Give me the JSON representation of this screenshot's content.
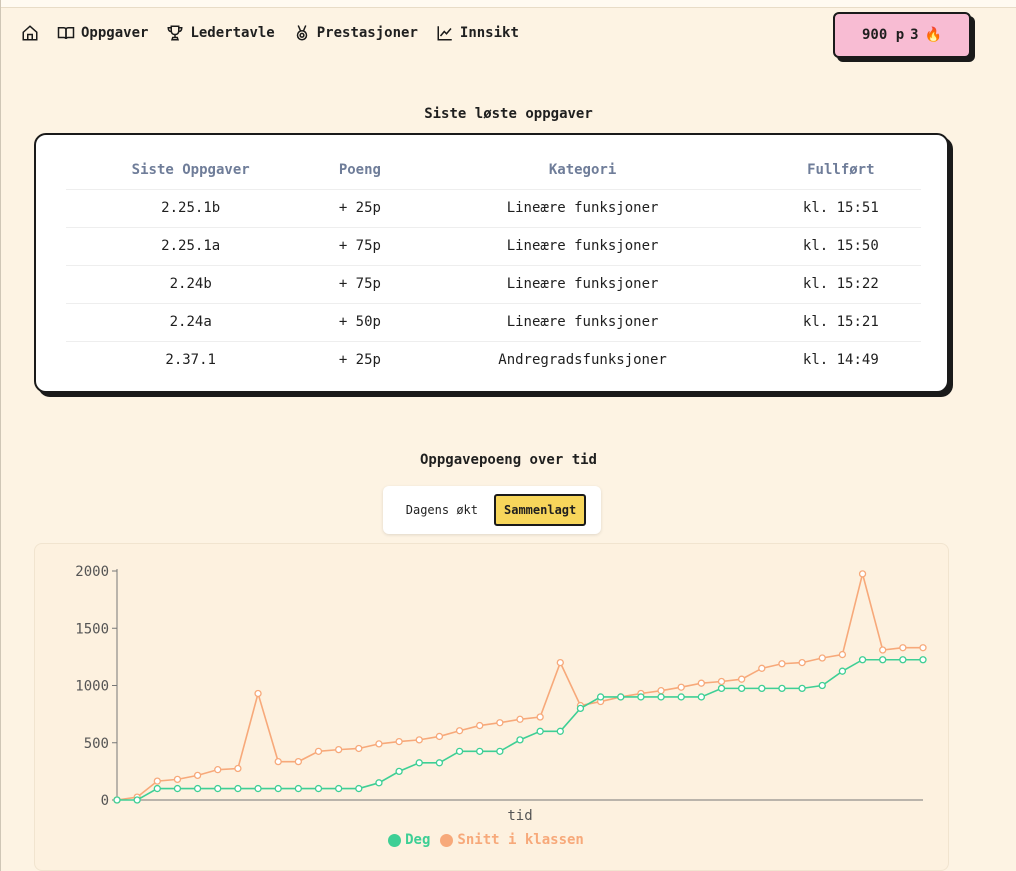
{
  "nav": {
    "home_label": "",
    "items": [
      {
        "label": "Oppgaver",
        "icon": "book-icon"
      },
      {
        "label": "Ledertavle",
        "icon": "trophy-icon"
      },
      {
        "label": "Prestasjoner",
        "icon": "medal-icon"
      },
      {
        "label": "Innsikt",
        "icon": "chart-icon"
      }
    ]
  },
  "score": {
    "points": "900 p",
    "streak": "3",
    "streak_icon": "🔥"
  },
  "recent": {
    "title": "Siste løste oppgaver",
    "headers": [
      "Siste Oppgaver",
      "Poeng",
      "Kategori",
      "Fullført"
    ],
    "rows": [
      [
        "2.25.1b",
        "+ 25p",
        "Lineære funksjoner",
        "kl. 15:51"
      ],
      [
        "2.25.1a",
        "+ 75p",
        "Lineære funksjoner",
        "kl. 15:50"
      ],
      [
        "2.24b",
        "+ 75p",
        "Lineære funksjoner",
        "kl. 15:22"
      ],
      [
        "2.24a",
        "+ 50p",
        "Lineære funksjoner",
        "kl. 15:21"
      ],
      [
        "2.37.1",
        "+ 25p",
        "Andregradsfunksjoner",
        "kl. 14:49"
      ]
    ]
  },
  "chart_section": {
    "title": "Oppgavepoeng over tid",
    "toggle": [
      "Dagens økt",
      "Sammenlagt"
    ],
    "active_toggle": 1
  },
  "chart_data": {
    "type": "line",
    "xlabel": "tid",
    "ylabel": "",
    "ylim": [
      0,
      2000
    ],
    "yticks": [
      0,
      500,
      1000,
      1500,
      2000
    ],
    "grid": false,
    "legend_position": "bottom",
    "x": [
      0,
      1,
      2,
      3,
      4,
      5,
      6,
      7,
      8,
      9,
      10,
      11,
      12,
      13,
      14,
      15,
      16,
      17,
      18,
      19,
      20,
      21,
      22,
      23,
      24,
      25,
      26,
      27,
      28,
      29,
      30,
      31,
      32,
      33,
      34,
      35,
      36,
      37,
      38,
      39,
      40
    ],
    "series": [
      {
        "name": "Deg",
        "color": "#3ecf95",
        "values": [
          0,
          0,
          100,
          100,
          100,
          100,
          100,
          100,
          100,
          100,
          100,
          100,
          100,
          150,
          250,
          325,
          325,
          425,
          425,
          425,
          525,
          600,
          600,
          800,
          900,
          900,
          900,
          900,
          900,
          900,
          975,
          975,
          975,
          975,
          975,
          1000,
          1125,
          1225,
          1225,
          1225,
          1225
        ]
      },
      {
        "name": "Snitt i klassen",
        "color": "#f7a97a",
        "values": [
          0,
          25,
          165,
          180,
          215,
          265,
          275,
          930,
          335,
          335,
          425,
          440,
          450,
          490,
          510,
          525,
          555,
          605,
          650,
          675,
          705,
          725,
          1200,
          825,
          860,
          900,
          930,
          955,
          985,
          1020,
          1035,
          1055,
          1150,
          1190,
          1200,
          1240,
          1270,
          1975,
          1310,
          1330,
          1330
        ]
      }
    ]
  }
}
